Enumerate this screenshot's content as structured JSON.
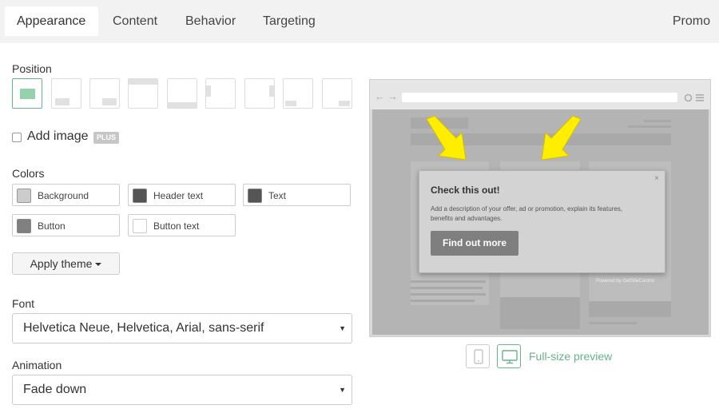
{
  "tabs": [
    {
      "label": "Appearance",
      "active": true
    },
    {
      "label": "Content",
      "active": false
    },
    {
      "label": "Behavior",
      "active": false
    },
    {
      "label": "Targeting",
      "active": false
    }
  ],
  "promo_label": "Promo",
  "position": {
    "label": "Position",
    "options": [
      "center",
      "bottom-left",
      "bottom-right",
      "top-bar",
      "bottom-bar",
      "left-side",
      "right-side",
      "corner-bottom-left",
      "corner-bottom-right"
    ],
    "selected": "center"
  },
  "add_image": {
    "label": "Add image",
    "badge": "PLUS",
    "checked": false
  },
  "colors": {
    "label": "Colors",
    "items": [
      {
        "label": "Background",
        "color": "#cccccc"
      },
      {
        "label": "Header text",
        "color": "#555555"
      },
      {
        "label": "Text",
        "color": "#555555"
      },
      {
        "label": "Button",
        "color": "#808080"
      },
      {
        "label": "Button text",
        "color": "#ffffff"
      }
    ]
  },
  "apply_theme_label": "Apply theme",
  "font": {
    "label": "Font",
    "value": "Helvetica Neue, Helvetica, Arial, sans-serif"
  },
  "animation": {
    "label": "Animation",
    "value": "Fade down"
  },
  "preview": {
    "popup_title": "Check this out!",
    "popup_description": "Add a description of your offer, ad or promotion, explain its features, benefits and advantages.",
    "popup_button": "Find out more",
    "close_glyph": "×",
    "powered_by": "Powered by GetSiteControl",
    "nav_back": "←",
    "nav_forward": "→",
    "accent_color": "#67b38a"
  },
  "full_size_preview_label": "Full-size preview"
}
